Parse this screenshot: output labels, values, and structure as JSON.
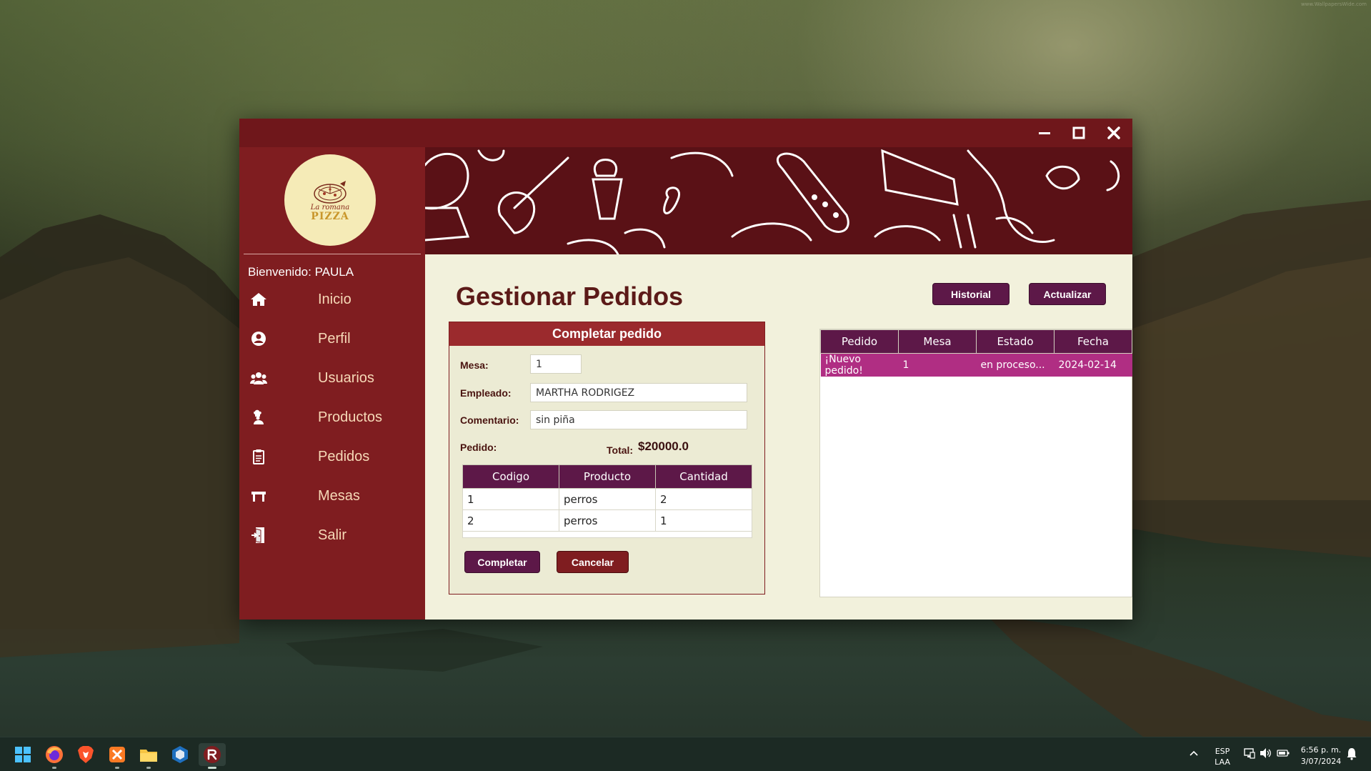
{
  "window": {
    "controls": {
      "minimize_icon": "minimize-icon",
      "maximize_icon": "maximize-icon",
      "close_icon": "close-icon"
    }
  },
  "sidebar": {
    "logo": {
      "line1": "La romana",
      "line2": "PIZZA"
    },
    "welcome_label": "Bienvenido:",
    "welcome_user": "PAULA",
    "items": [
      {
        "label": "Inicio",
        "icon": "home-icon"
      },
      {
        "label": "Perfil",
        "icon": "user-circle-icon"
      },
      {
        "label": "Usuarios",
        "icon": "users-icon"
      },
      {
        "label": "Productos",
        "icon": "chef-icon"
      },
      {
        "label": "Pedidos",
        "icon": "clipboard-icon"
      },
      {
        "label": "Mesas",
        "icon": "table-icon"
      },
      {
        "label": "Salir",
        "icon": "exit-door-icon"
      }
    ]
  },
  "main": {
    "title": "Gestionar Pedidos",
    "buttons": {
      "historial": "Historial",
      "actualizar": "Actualizar"
    },
    "complete_panel": {
      "header": "Completar pedido",
      "mesa_label": "Mesa:",
      "mesa_value": "1",
      "empleado_label": "Empleado:",
      "empleado_value": "MARTHA RODRIGEZ",
      "comentario_label": "Comentario:",
      "comentario_value": "sin piña",
      "pedido_label": "Pedido:",
      "total_label": "Total:",
      "total_value": "$20000.0",
      "table": {
        "columns": [
          "Codigo",
          "Producto",
          "Cantidad"
        ],
        "rows": [
          [
            "1",
            "perros",
            "2"
          ],
          [
            "2",
            "perros",
            "1"
          ]
        ]
      },
      "completar_label": "Completar",
      "cancelar_label": "Cancelar"
    },
    "orders_table": {
      "columns": [
        "Pedido",
        "Mesa",
        "Estado",
        "Fecha"
      ],
      "rows": [
        [
          "¡Nuevo pedido!",
          "1",
          "en proceso...",
          "2024-02-14"
        ]
      ]
    }
  },
  "taskbar": {
    "apps": [
      "windows-start-icon",
      "firefox-icon",
      "brave-icon",
      "xampp-icon",
      "file-explorer-icon",
      "virtualbox-icon",
      "app-r-icon"
    ],
    "lang_line1": "ESP",
    "lang_line2": "LAA",
    "time": "6:56 p. m.",
    "date": "3/07/2024"
  },
  "colors": {
    "titlebar": "#6f171b",
    "sidebar": "#7f1d20",
    "accent_purple": "#5d1848",
    "selected_row": "#b02e83",
    "content_bg": "#f2f1dc"
  }
}
